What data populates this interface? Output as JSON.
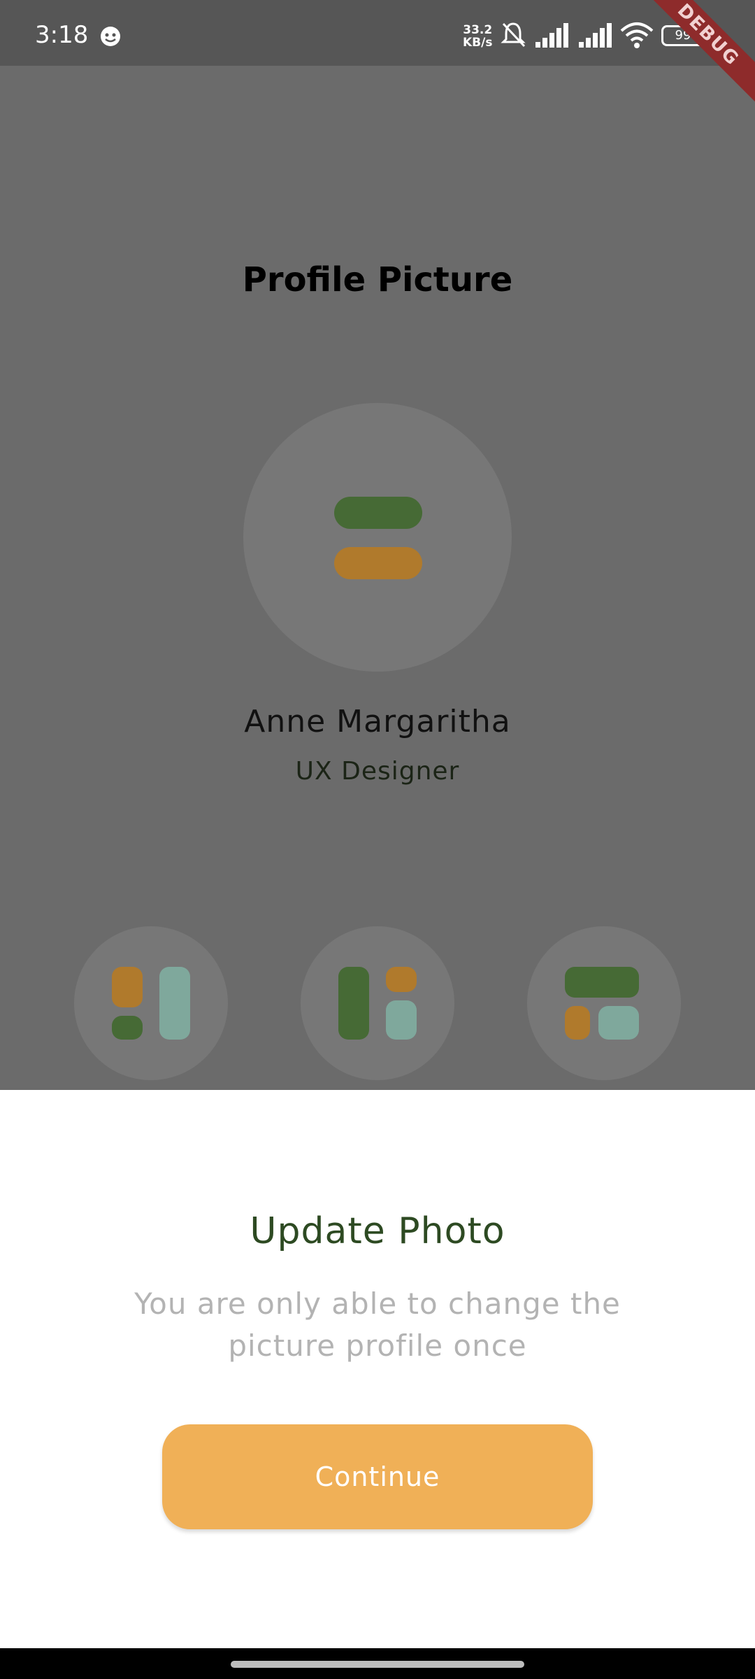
{
  "status": {
    "time": "3:18",
    "speed_value": "33.2",
    "speed_unit": "KB/s",
    "battery": "99",
    "debug": "DEBUG"
  },
  "page": {
    "title": "Profile Picture"
  },
  "profile": {
    "name": "Anne Margaritha",
    "role": "UX Designer"
  },
  "colors": {
    "green": "#466a35",
    "orange": "#b07a2c",
    "teal": "#7fa89c",
    "accent": "#f0b057",
    "title_green": "#2d4a22"
  },
  "sheet": {
    "title": "Update Photo",
    "description": "You are only able to change the picture profile once",
    "button_label": "Continue"
  }
}
